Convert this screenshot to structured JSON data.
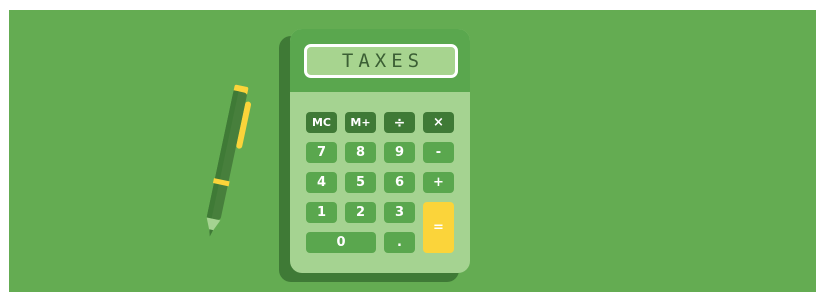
{
  "screen": {
    "text": "TAXES"
  },
  "keys": {
    "mc": "MC",
    "m_plus": "M+",
    "divide": "÷",
    "multiply": "×",
    "k7": "7",
    "k8": "8",
    "k9": "9",
    "minus": "-",
    "k4": "4",
    "k5": "5",
    "k6": "6",
    "plus": "+",
    "k1": "1",
    "k2": "2",
    "k3": "3",
    "k0": "0",
    "dot": ".",
    "equals": "="
  },
  "colors": {
    "background": "#64ac52",
    "calculator_body": "#a5d391",
    "calculator_top": "#5aa74e",
    "key_dark": "#3f7a36",
    "key_green": "#5aa74e",
    "equals_key": "#fbd43a",
    "pen_body": "#477f3c",
    "pen_accent": "#fbd43a"
  },
  "icons": {
    "pen": "pen-icon",
    "calculator": "calculator-icon"
  }
}
